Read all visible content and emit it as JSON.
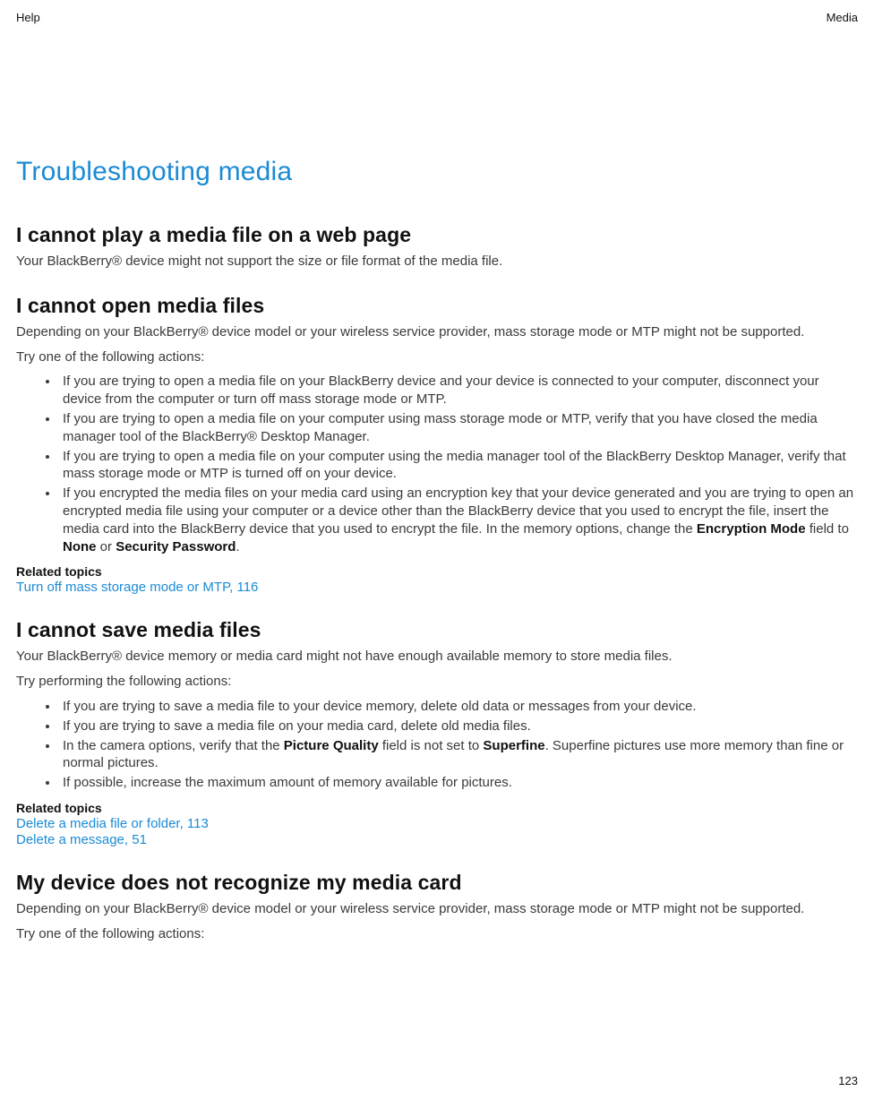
{
  "header": {
    "left": "Help",
    "right": "Media"
  },
  "footer": {
    "page": "123"
  },
  "title": "Troubleshooting media",
  "sections": {
    "s1": {
      "heading": "I cannot play a media file on a web page",
      "p1": "Your BlackBerry® device might not support the size or file format of the media file."
    },
    "s2": {
      "heading": "I cannot open media files",
      "p1": "Depending on your BlackBerry® device model or your wireless service provider, mass storage mode or MTP might not be supported.",
      "p2": "Try one of the following actions:",
      "b1": "If you are trying to open a media file on your BlackBerry device and your device is connected to your computer, disconnect your device from the computer or turn off mass storage mode or MTP.",
      "b2": "If you are trying to open a media file on your computer using mass storage mode or MTP, verify that you have closed the media manager tool of the BlackBerry® Desktop Manager.",
      "b3": "If you are trying to open a media file on your computer using the media manager tool of the BlackBerry Desktop Manager, verify that mass storage mode or MTP is turned off on your device.",
      "b4_a": "If you encrypted the media files on your media card using an encryption key that your device generated and you are trying to open an encrypted media file using your computer or a device other than the BlackBerry device that you used to encrypt the file, insert the media card into the BlackBerry device that you used to encrypt the file. In the memory options, change the ",
      "b4_em1": "Encryption Mode",
      "b4_b": " field to ",
      "b4_em2": "None",
      "b4_c": " or ",
      "b4_em3": "Security Password",
      "b4_d": ".",
      "related_label": "Related topics",
      "link1": "Turn off mass storage mode or MTP, 116"
    },
    "s3": {
      "heading": "I cannot save media files",
      "p1": "Your BlackBerry® device memory or media card might not have enough available memory to store media files.",
      "p2": "Try performing the following actions:",
      "b1": "If you are trying to save a media file to your device memory, delete old data or messages from your device.",
      "b2": "If you are trying to save a media file on your media card, delete old media files.",
      "b3_a": "In the camera options, verify that the ",
      "b3_em1": "Picture Quality",
      "b3_b": " field is not set to ",
      "b3_em2": "Superfine",
      "b3_c": ". Superfine pictures use more memory than fine or normal pictures.",
      "b4": "If possible, increase the maximum amount of memory available for pictures.",
      "related_label": "Related topics",
      "link1": "Delete a media file or folder, 113",
      "link2": "Delete a message, 51"
    },
    "s4": {
      "heading": "My device does not recognize my media card",
      "p1": "Depending on your BlackBerry® device model or your wireless service provider, mass storage mode or MTP might not be supported.",
      "p2": "Try one of the following actions:"
    }
  }
}
